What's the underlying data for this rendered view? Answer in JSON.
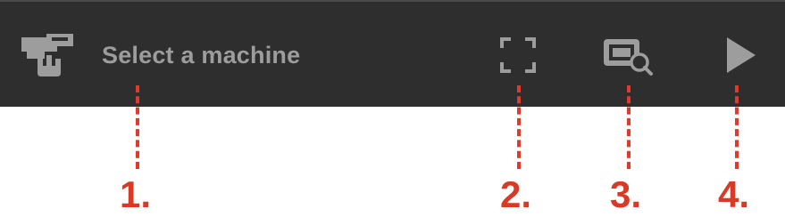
{
  "toolbar": {
    "machine_selector": {
      "label": "Select a machine",
      "icon": "machine-icon"
    },
    "fullscreen_icon": "fullscreen-icon",
    "inspect_icon": "screen-inspect-icon",
    "play_icon": "play-icon"
  },
  "callouts": [
    {
      "label": "1."
    },
    {
      "label": "2."
    },
    {
      "label": "3."
    },
    {
      "label": "4."
    }
  ],
  "colors": {
    "toolbar_bg": "#2e2e2e",
    "icon_gray": "#9d9d9d",
    "callout_red": "#d83a26"
  }
}
